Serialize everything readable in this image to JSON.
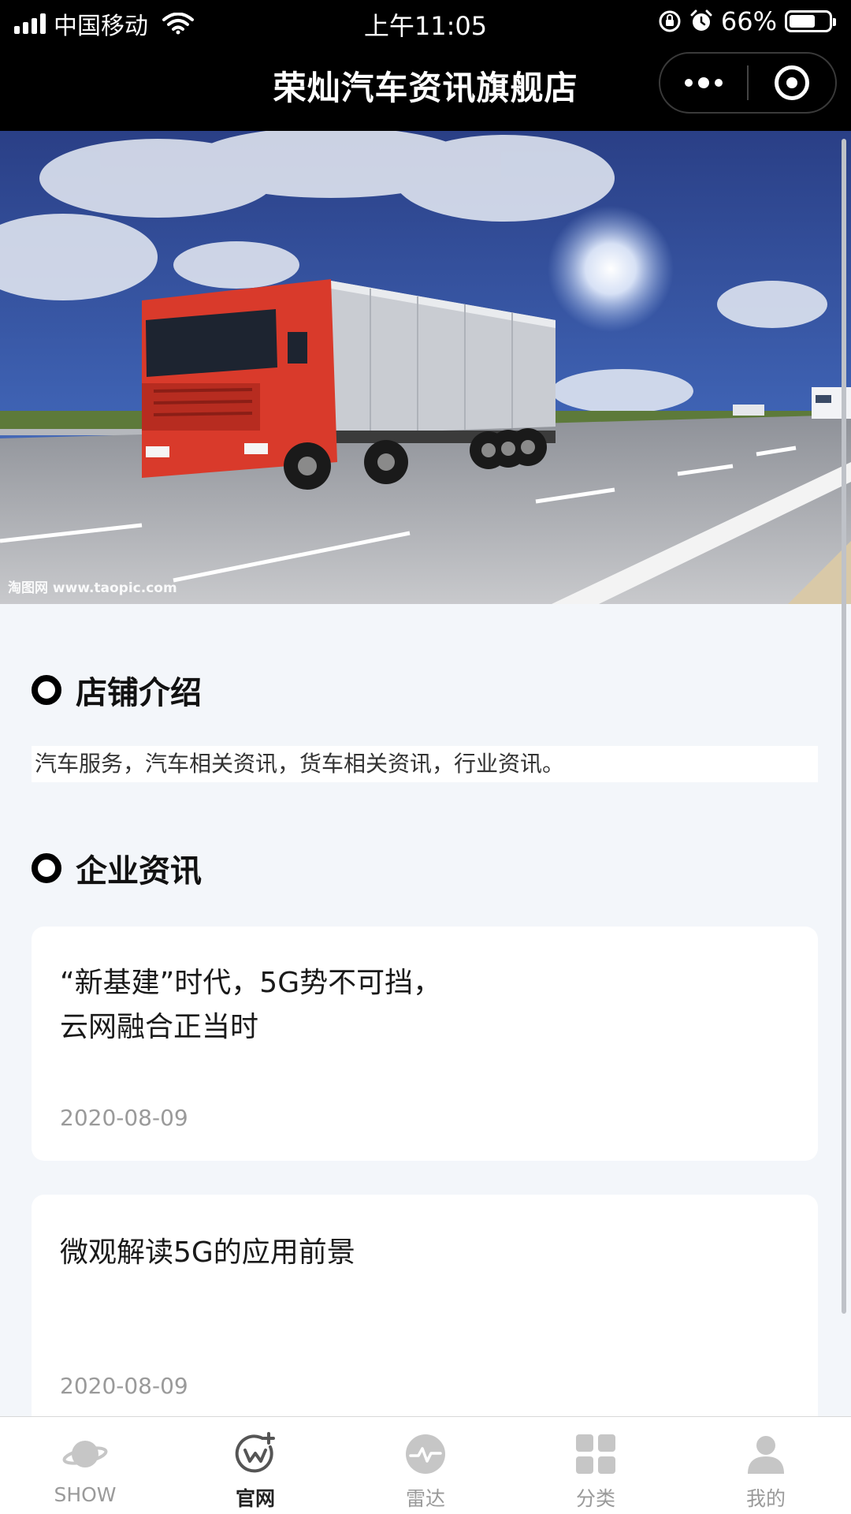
{
  "status_bar": {
    "carrier": "中国移动",
    "time": "上午11:05",
    "battery": "66%",
    "battery_level": 0.66,
    "icons": [
      "signal-icon",
      "wifi-icon",
      "rotation-lock-icon",
      "alarm-icon",
      "battery-icon"
    ]
  },
  "nav": {
    "title": "荣灿汽车资讯旗舰店",
    "more_icon": "more-dots-icon",
    "close_icon": "target-close-icon"
  },
  "banner": {
    "watermark": "淘图网 www.taopic.com"
  },
  "shop_intro": {
    "title": "店铺介绍",
    "text": "汽车服务，汽车相关资讯，货车相关资讯，行业资讯。"
  },
  "news": {
    "title": "企业资讯",
    "items": [
      {
        "headline_line1": "“新基建”时代，5G势不可挡，",
        "headline_line2": "云网融合正当时",
        "date": "2020-08-09"
      },
      {
        "headline_line1": "微观解读5G的应用前景",
        "headline_line2": "",
        "date": "2020-08-09"
      }
    ]
  },
  "tabbar": {
    "items": [
      {
        "label": "SHOW",
        "icon": "planet-icon",
        "active": false
      },
      {
        "label": "官网",
        "icon": "website-icon",
        "active": true
      },
      {
        "label": "雷达",
        "icon": "radar-icon",
        "active": false
      },
      {
        "label": "分类",
        "icon": "grid-icon",
        "active": false
      },
      {
        "label": "我的",
        "icon": "user-icon",
        "active": false
      }
    ]
  },
  "colors": {
    "nav_bg": "#000000",
    "page_bg": "#f3f6fa",
    "card_bg": "#ffffff",
    "date_gray": "#9a9a9a",
    "tab_inactive": "#9a9a9a"
  }
}
